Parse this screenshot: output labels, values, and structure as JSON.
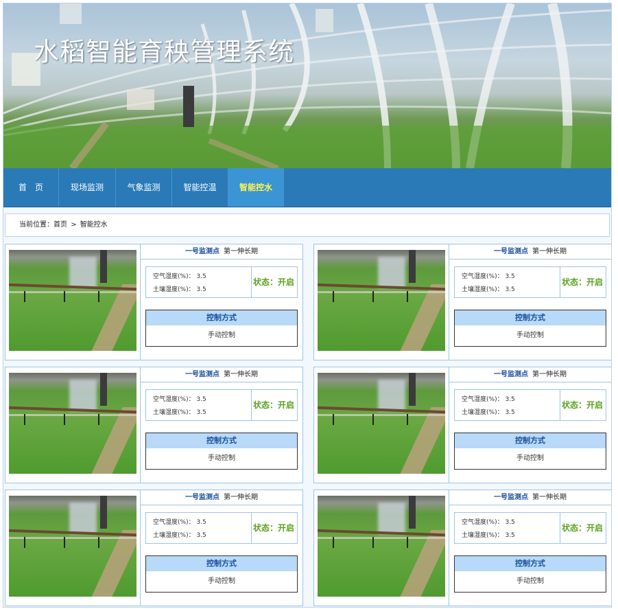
{
  "banner": {
    "title": "水稻智能育秧管理系统"
  },
  "nav": {
    "items": [
      {
        "label": "首　页"
      },
      {
        "label": "现场监测"
      },
      {
        "label": "气象监测"
      },
      {
        "label": "智能控温"
      },
      {
        "label": "智能控水"
      }
    ],
    "active": "智能控水"
  },
  "breadcrumb": {
    "prefix": "当前位置：",
    "home": "首页",
    "separator": ">",
    "current": "智能控水"
  },
  "cards": [
    {
      "point": "一号监测点",
      "stage": "第一伸长期",
      "air_label": "空气湿度(%)：",
      "air_value": "3.5",
      "soil_label": "土壤湿度(%)：",
      "soil_value": "3.5",
      "status": "状态：开启",
      "control_header": "控制方式",
      "control_mode": "手动控制"
    },
    {
      "point": "一号监测点",
      "stage": "第一伸长期",
      "air_label": "空气湿度(%)：",
      "air_value": "3.5",
      "soil_label": "土壤湿度(%)：",
      "soil_value": "3.5",
      "status": "状态：开启",
      "control_header": "控制方式",
      "control_mode": "手动控制"
    },
    {
      "point": "一号监测点",
      "stage": "第一伸长期",
      "air_label": "空气湿度(%)：",
      "air_value": "3.5",
      "soil_label": "土壤湿度(%)：",
      "soil_value": "3.5",
      "status": "状态：开启",
      "control_header": "控制方式",
      "control_mode": "手动控制"
    },
    {
      "point": "一号监测点",
      "stage": "第一伸长期",
      "air_label": "空气湿度(%)：",
      "air_value": "3.5",
      "soil_label": "土壤湿度(%)：",
      "soil_value": "3.5",
      "status": "状态：开启",
      "control_header": "控制方式",
      "control_mode": "手动控制"
    },
    {
      "point": "一号监测点",
      "stage": "第一伸长期",
      "air_label": "空气湿度(%)：",
      "air_value": "3.5",
      "soil_label": "土壤湿度(%)：",
      "soil_value": "3.5",
      "status": "状态：开启",
      "control_header": "控制方式",
      "control_mode": "手动控制"
    },
    {
      "point": "一号监测点",
      "stage": "第一伸长期",
      "air_label": "空气湿度(%)：",
      "air_value": "3.5",
      "soil_label": "土壤湿度(%)：",
      "soil_value": "3.5",
      "status": "状态：开启",
      "control_header": "控制方式",
      "control_mode": "手动控制"
    }
  ],
  "colors": {
    "nav_bg": "#2a7ab8",
    "nav_active_text": "#fff54a",
    "status_text": "#5aa31f",
    "control_header_bg": "#b8daf8"
  }
}
